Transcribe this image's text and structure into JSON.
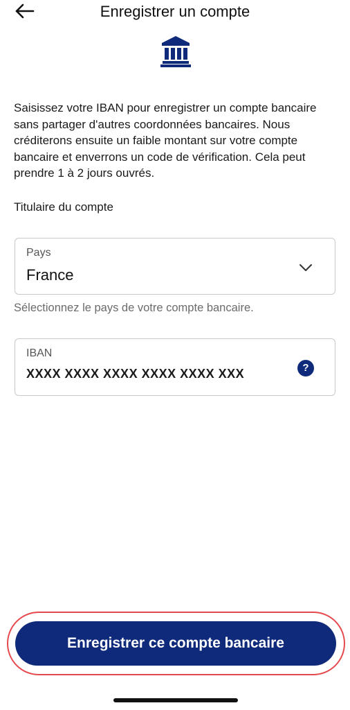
{
  "header": {
    "title": "Enregistrer un compte",
    "back_icon": "arrow-left-icon"
  },
  "hero_icon": "bank-icon",
  "description": "Saisissez votre IBAN pour enregistrer un compte bancaire sans partager d'autres coordonnées bancaires. Nous créditerons ensuite un faible montant sur votre compte bancaire et enverrons un code de vérification. Cela peut prendre 1 à 2 jours ouvrés.",
  "account_holder": {
    "label": "Titulaire du compte"
  },
  "country_field": {
    "label": "Pays",
    "value": "France",
    "helper": "Sélectionnez le pays de votre compte bancaire.",
    "icon": "chevron-down-icon"
  },
  "iban_field": {
    "label": "IBAN",
    "placeholder": "XXXX XXXX XXXX XXXX XXXX XXX",
    "help_icon": "question-circle-icon",
    "help_glyph": "?"
  },
  "submit": {
    "label": "Enregistrer ce compte bancaire"
  },
  "colors": {
    "primary": "#0f2a7a",
    "highlight_outline": "#e5484d",
    "border": "#c8c8c8",
    "helper_text": "#6b6b6b"
  }
}
